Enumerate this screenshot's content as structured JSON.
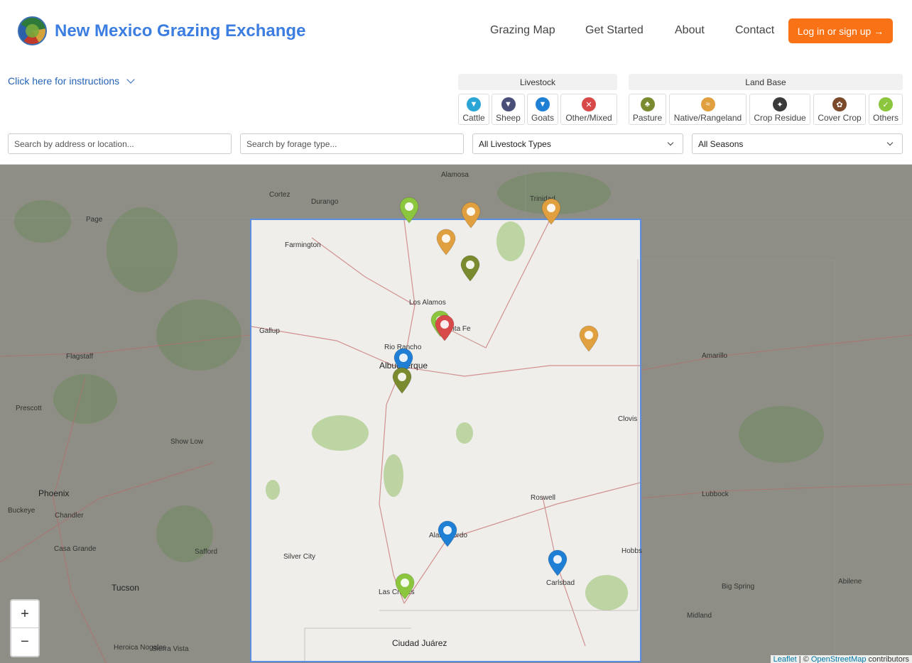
{
  "header": {
    "brand": "New Mexico Grazing Exchange",
    "nav": [
      "Grazing Map",
      "Get Started",
      "About",
      "Contact"
    ],
    "login": "Log in or sign up →"
  },
  "instructions": "Click here for instructions",
  "livestock": {
    "title": "Livestock",
    "items": [
      {
        "label": "Cattle",
        "color": "#2aa5d6",
        "icon": "cow-icon"
      },
      {
        "label": "Sheep",
        "color": "#4a4f7a",
        "icon": "sheep-icon"
      },
      {
        "label": "Goats",
        "color": "#1f7fd4",
        "icon": "goat-icon"
      },
      {
        "label": "Other/Mixed",
        "color": "#d84a4a",
        "icon": "mixed-icon"
      }
    ]
  },
  "landbase": {
    "title": "Land Base",
    "items": [
      {
        "label": "Pasture",
        "color": "#7a8a2e",
        "icon": "pasture-icon"
      },
      {
        "label": "Native/Rangeland",
        "color": "#e0a040",
        "icon": "rangeland-icon"
      },
      {
        "label": "Crop Residue",
        "color": "#3a3a3a",
        "icon": "crop-residue-icon"
      },
      {
        "label": "Cover Crop",
        "color": "#7a4a2a",
        "icon": "cover-crop-icon"
      },
      {
        "label": "Others",
        "color": "#8cc63f",
        "icon": "others-icon"
      }
    ]
  },
  "search": {
    "address_placeholder": "Search by address or location...",
    "forage_placeholder": "Search by forage type...",
    "livestock_select": "All Livestock Types",
    "season_select": "All Seasons"
  },
  "map": {
    "places": [
      "Alamosa",
      "Cortez",
      "Durango",
      "Trinidad",
      "Page",
      "Farmington",
      "Los Alamos",
      "Santa Fe",
      "Gallup",
      "Rio Rancho",
      "Albuquerque",
      "Flagstaff",
      "Amarillo",
      "Prescott",
      "Show Low",
      "Clovis",
      "Phoenix",
      "Buckeye",
      "Chandler",
      "Lubbock",
      "Roswell",
      "Alamogordo",
      "Casa Grande",
      "Safford",
      "Silver City",
      "Hobbs",
      "Carlsbad",
      "Big Spring",
      "Abilene",
      "Tucson",
      "Midland",
      "Las Cruces",
      "Ciudad Juárez",
      "Heroica Nogales",
      "Sierra Vista"
    ],
    "zoom_in": "+",
    "zoom_out": "−",
    "attribution_leaflet": "Leaflet",
    "attribution_sep": " | © ",
    "attribution_osm": "OpenStreetMap",
    "attribution_tail": " contributors"
  }
}
